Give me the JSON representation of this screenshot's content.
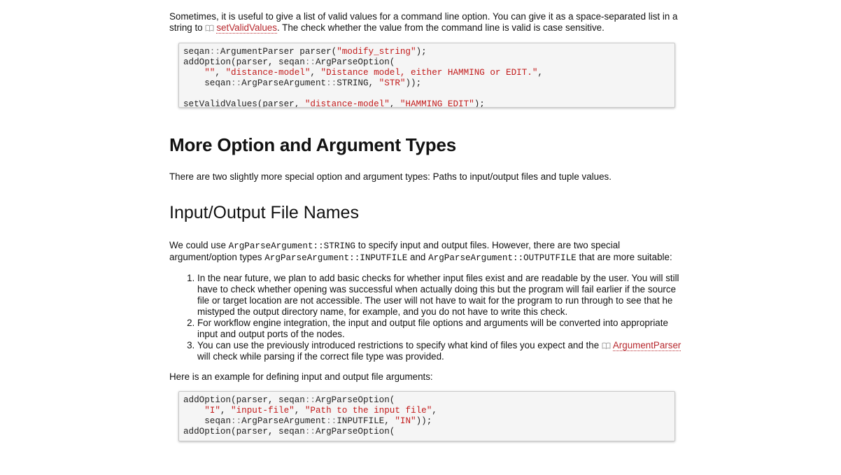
{
  "intro_paragraph": {
    "before": "Sometimes, it is useful to give a list of valid values for a command line option. You can give it as a space-separated list in a string to ",
    "link": "setValidValues",
    "after": ". The check whether the value from the command line is valid is case sensitive."
  },
  "code1": {
    "line1": {
      "a": "seqan",
      "b": "::",
      "c": "ArgumentParser parser(",
      "s": "\"modify_string\"",
      "d": ");"
    },
    "line2": {
      "a": "addOption(parser, seqan",
      "b": "::",
      "c": "ArgParseOption("
    },
    "line3": {
      "indent": "    ",
      "s1": "\"\"",
      "c1": ", ",
      "s2": "\"distance-model\"",
      "c2": ", ",
      "s3": "\"Distance model, either HAMMING or EDIT.\"",
      "c3": ","
    },
    "line4": {
      "indent": "    ",
      "a": "seqan",
      "b": "::",
      "c": "ArgParseArgument",
      "d": "::",
      "e": "STRING, ",
      "s": "\"STR\"",
      "f": "));"
    },
    "line6": {
      "a": "setValidValues(parser, ",
      "s1": "\"distance-model\"",
      "c": ", ",
      "s2": "\"HAMMING EDIT\"",
      "d": ");"
    }
  },
  "heading_more_types": "More Option and Argument Types",
  "more_types_paragraph": "There are two slightly more special option and argument types: Paths to input/output files and tuple values.",
  "heading_io_files": "Input/Output File Names",
  "io_paragraph": {
    "t1": "We could use ",
    "c1": "ArgParseArgument::STRING",
    "t2": " to specify input and output files. However, there are two special argument/option types ",
    "c2": "ArgParseArgument::INPUTFILE",
    "t3": " and ",
    "c3": "ArgParseArgument::OUTPUTFILE",
    "t4": " that are more suitable:"
  },
  "list": {
    "item1": "In the near future, we plan to add basic checks for whether input files exist and are readable by the user. You will still have to check whether opening was successful when actually doing this but the program will fail earlier if the source file or target location are not accessible. The user will not have to wait for the program to run through to see that he mistyped the output directory name, for example, and you do not have to write this check.",
    "item2": "For workflow engine integration, the input and output file options and arguments will be converted into appropriate input and output ports of the nodes.",
    "item3_before": "You can use the previously introduced restrictions to specify what kind of files you expect and the ",
    "item3_link": "ArgumentParser",
    "item3_after": " will check while parsing if the correct file type was provided."
  },
  "example_paragraph": "Here is an example for defining input and output file arguments:",
  "code2": {
    "line1": {
      "a": "addOption(parser, seqan",
      "b": "::",
      "c": "ArgParseOption("
    },
    "line2": {
      "indent": "    ",
      "s1": "\"I\"",
      "c1": ", ",
      "s2": "\"input-file\"",
      "c2": ", ",
      "s3": "\"Path to the input file\"",
      "c3": ","
    },
    "line3": {
      "indent": "    ",
      "a": "seqan",
      "b": "::",
      "c": "ArgParseArgument",
      "d": "::",
      "e": "INPUTFILE, ",
      "s": "\"IN\"",
      "f": "));"
    },
    "line4": {
      "a": "addOption(parser, seqan",
      "b": "::",
      "c": "ArgParseOption("
    }
  },
  "colors": {
    "link": "#b7282e",
    "string": "#c21b1b",
    "code_bg": "#f5f5f5"
  },
  "icons": {
    "doc_link": "book-icon"
  }
}
